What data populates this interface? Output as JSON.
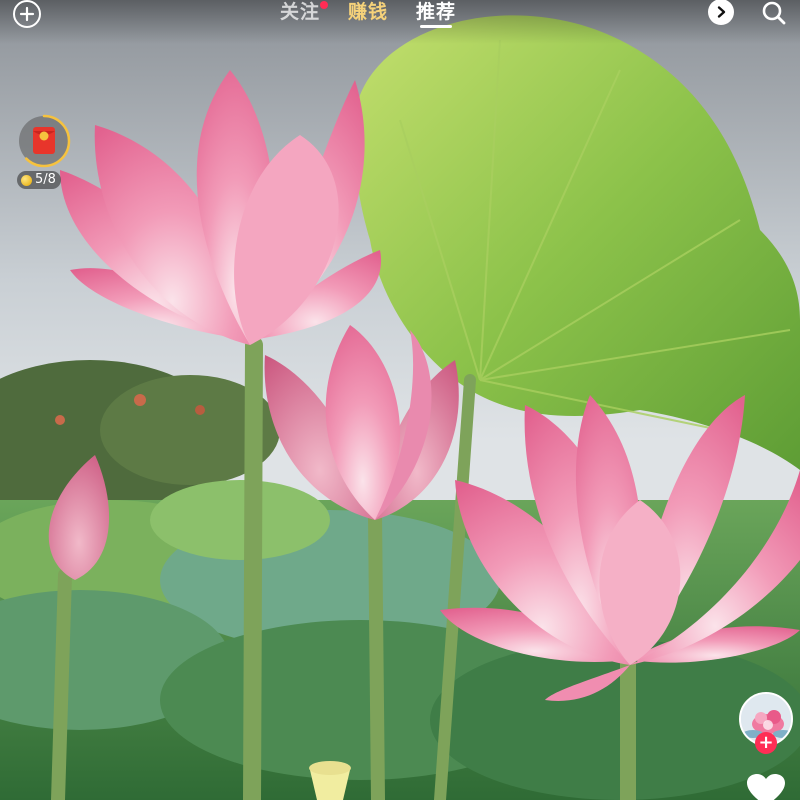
{
  "app": {
    "colors": {
      "accent": "#ff2d55",
      "earn_tab": "#f6d27a",
      "text": "#ffffff"
    }
  },
  "topbar": {
    "tabs": [
      {
        "label": "关注",
        "has_dot": true,
        "active": false
      },
      {
        "label": "赚钱",
        "has_dot": false,
        "active": false
      },
      {
        "label": "推荐",
        "has_dot": false,
        "active": true
      }
    ],
    "icons": {
      "left": "add-circle-icon",
      "right_1": "play-forward-icon",
      "right_2": "search-icon"
    }
  },
  "envelope_widget": {
    "icon": "red-envelope-icon",
    "progress_text": "5/8",
    "progress_fraction": 0.625
  },
  "creator": {
    "avatar_icon": "creator-avatar-image",
    "follow_label": "+"
  },
  "like": {
    "icon": "heart-icon"
  }
}
